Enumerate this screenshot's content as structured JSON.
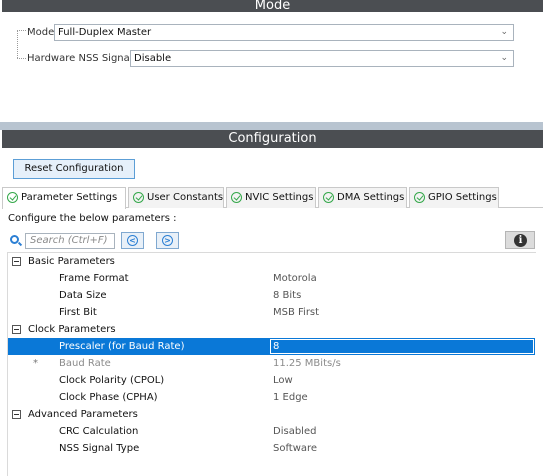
{
  "mode_section": {
    "title": "Mode",
    "fields": [
      {
        "label": "Mode",
        "value": "Full-Duplex Master"
      },
      {
        "label": "Hardware NSS Signal",
        "value": "Disable"
      }
    ]
  },
  "config_section": {
    "title": "Configuration",
    "reset_button": "Reset Configuration",
    "tabs": [
      {
        "label": "Parameter Settings",
        "active": true
      },
      {
        "label": "User Constants"
      },
      {
        "label": "NVIC Settings"
      },
      {
        "label": "DMA Settings"
      },
      {
        "label": "GPIO Settings"
      }
    ],
    "instruction": "Configure the below parameters :",
    "search_placeholder": "Search (Ctrl+F)",
    "groups": [
      {
        "label": "Basic Parameters",
        "params": [
          {
            "label": "Frame Format",
            "value": "Motorola"
          },
          {
            "label": "Data Size",
            "value": "8 Bits"
          },
          {
            "label": "First Bit",
            "value": "MSB First"
          }
        ]
      },
      {
        "label": "Clock Parameters",
        "params": [
          {
            "label": "Prescaler (for Baud Rate)",
            "value": "8"
          },
          {
            "label": "Baud Rate",
            "value": "11.25 MBits/s",
            "marker": "*"
          },
          {
            "label": "Clock Polarity (CPOL)",
            "value": "Low"
          },
          {
            "label": "Clock Phase (CPHA)",
            "value": "1 Edge"
          }
        ]
      },
      {
        "label": "Advanced Parameters",
        "params": [
          {
            "label": "CRC Calculation",
            "value": "Disabled"
          },
          {
            "label": "NSS Signal Type",
            "value": "Software"
          }
        ]
      }
    ]
  },
  "colors": {
    "section_bar": "#4b4e52",
    "selection": "#0a78d7",
    "check_green": "#35a84b",
    "icon_blue": "#2b7fd4"
  },
  "icons": [
    "chevron-down-icon",
    "check-circle-icon",
    "search-icon",
    "arrow-left-icon",
    "arrow-right-icon",
    "info-icon",
    "collapse-icon"
  ]
}
